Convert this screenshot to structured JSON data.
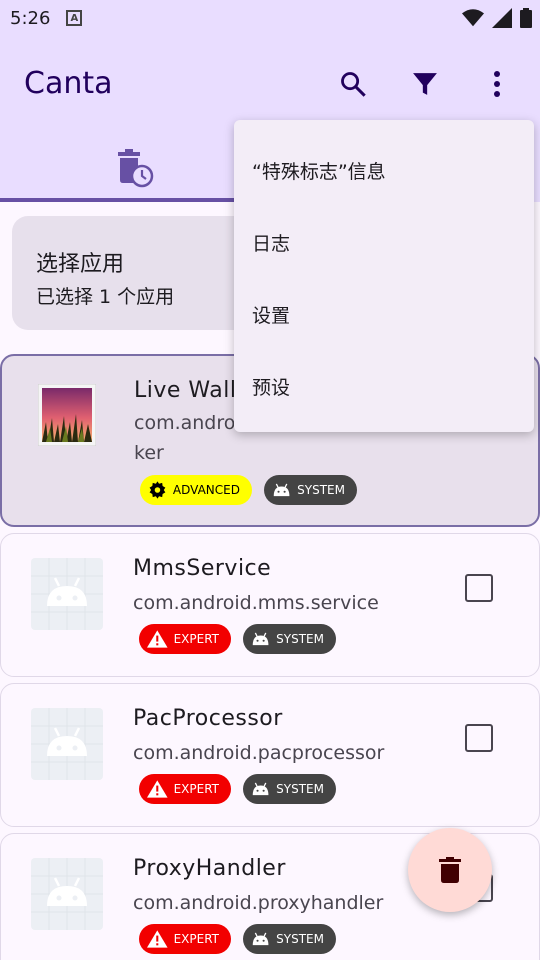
{
  "status_bar": {
    "time": "5:26",
    "a_label": "A"
  },
  "app_bar": {
    "title": "Canta",
    "actions": [
      "search",
      "filter",
      "more"
    ]
  },
  "tabs": {
    "active_icon": "delete-clock-icon"
  },
  "selection_card": {
    "title": "选择应用",
    "subtitle": "已选择 1 个应用"
  },
  "apps": [
    {
      "name": "Live Wall",
      "package_line1": "com.androi",
      "package_line2": "ker",
      "badges": [
        {
          "type": "advanced",
          "label": "ADVANCED"
        },
        {
          "type": "system",
          "label": "SYSTEM"
        }
      ],
      "selected": true
    },
    {
      "name": "MmsService",
      "package": "com.android.mms.service",
      "badges": [
        {
          "type": "expert",
          "label": "EXPERT"
        },
        {
          "type": "system",
          "label": "SYSTEM"
        }
      ],
      "checked": false
    },
    {
      "name": "PacProcessor",
      "package": "com.android.pacprocessor",
      "badges": [
        {
          "type": "expert",
          "label": "EXPERT"
        },
        {
          "type": "system",
          "label": "SYSTEM"
        }
      ],
      "checked": false
    },
    {
      "name": "ProxyHandler",
      "package": "com.android.proxyhandler",
      "badges": [
        {
          "type": "expert",
          "label": "EXPERT"
        },
        {
          "type": "system",
          "label": "SYSTEM"
        }
      ],
      "checked": false
    }
  ],
  "menu": {
    "items": [
      "“特殊标志”信息",
      "日志",
      "设置",
      "预设"
    ]
  },
  "colors": {
    "app_bar_bg": "#e9ddff",
    "primary": "#6750a4",
    "on_primary_container": "#21005d",
    "advanced_badge": "#ffff00",
    "expert_badge": "#f20000",
    "system_badge": "#444444",
    "fab_bg": "#ffdad6",
    "fab_icon": "#410002"
  }
}
